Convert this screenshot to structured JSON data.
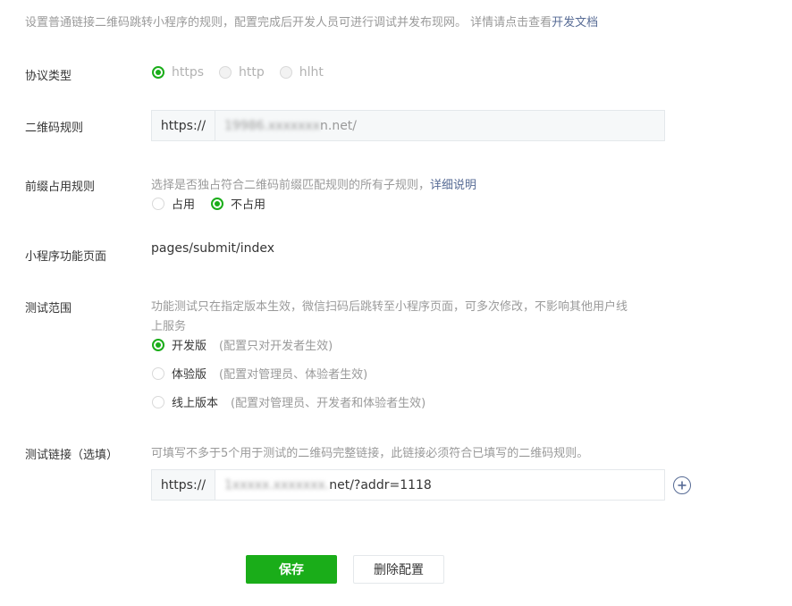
{
  "intro": {
    "text": "设置普通链接二维码跳转小程序的规则，配置完成后开发人员可进行调试并发布现网。 详情请点击查看",
    "link": "开发文档"
  },
  "protocol": {
    "label": "协议类型",
    "options": [
      "https",
      "http",
      "hlht"
    ],
    "selected": "https"
  },
  "qr_rule": {
    "label": "二维码规则",
    "prefix": "https://",
    "value_blur": "1",
    "value_visible": "9986.xxxxxxx",
    "value_suffix": "n.net/"
  },
  "prefix_rule": {
    "label": "前缀占用规则",
    "hint": "选择是否独占符合二维码前缀匹配规则的所有子规则，",
    "hint_link": "详细说明",
    "options": [
      "占用",
      "不占用"
    ],
    "selected": "不占用"
  },
  "page": {
    "label": "小程序功能页面",
    "value": "pages/submit/index"
  },
  "test_scope": {
    "label": "测试范围",
    "hint_line1": "功能测试只在指定版本生效，微信扫码后跳转至小程序页面，可多次修改，不影响其他用户线",
    "hint_line2": "上服务",
    "options": [
      {
        "name": "开发版",
        "note": "(配置只对开发者生效)"
      },
      {
        "name": "体验版",
        "note": "(配置对管理员、体验者生效)"
      },
      {
        "name": "线上版本",
        "note": "(配置对管理员、开发者和体验者生效)"
      }
    ],
    "selected": "开发版"
  },
  "test_link": {
    "label": "测试链接（选填）",
    "hint": "可填写不多于5个用于测试的二维码完整链接，此链接必须符合已填写的二维码规则。",
    "prefix": "https://",
    "value_blur": "1xxxxx.xxxxxxx.",
    "value_suffix": "net/?addr=1118"
  },
  "buttons": {
    "save": "保存",
    "delete": "删除配置"
  },
  "colors": {
    "accent_green": "#1aad19",
    "link_blue": "#576b95"
  }
}
